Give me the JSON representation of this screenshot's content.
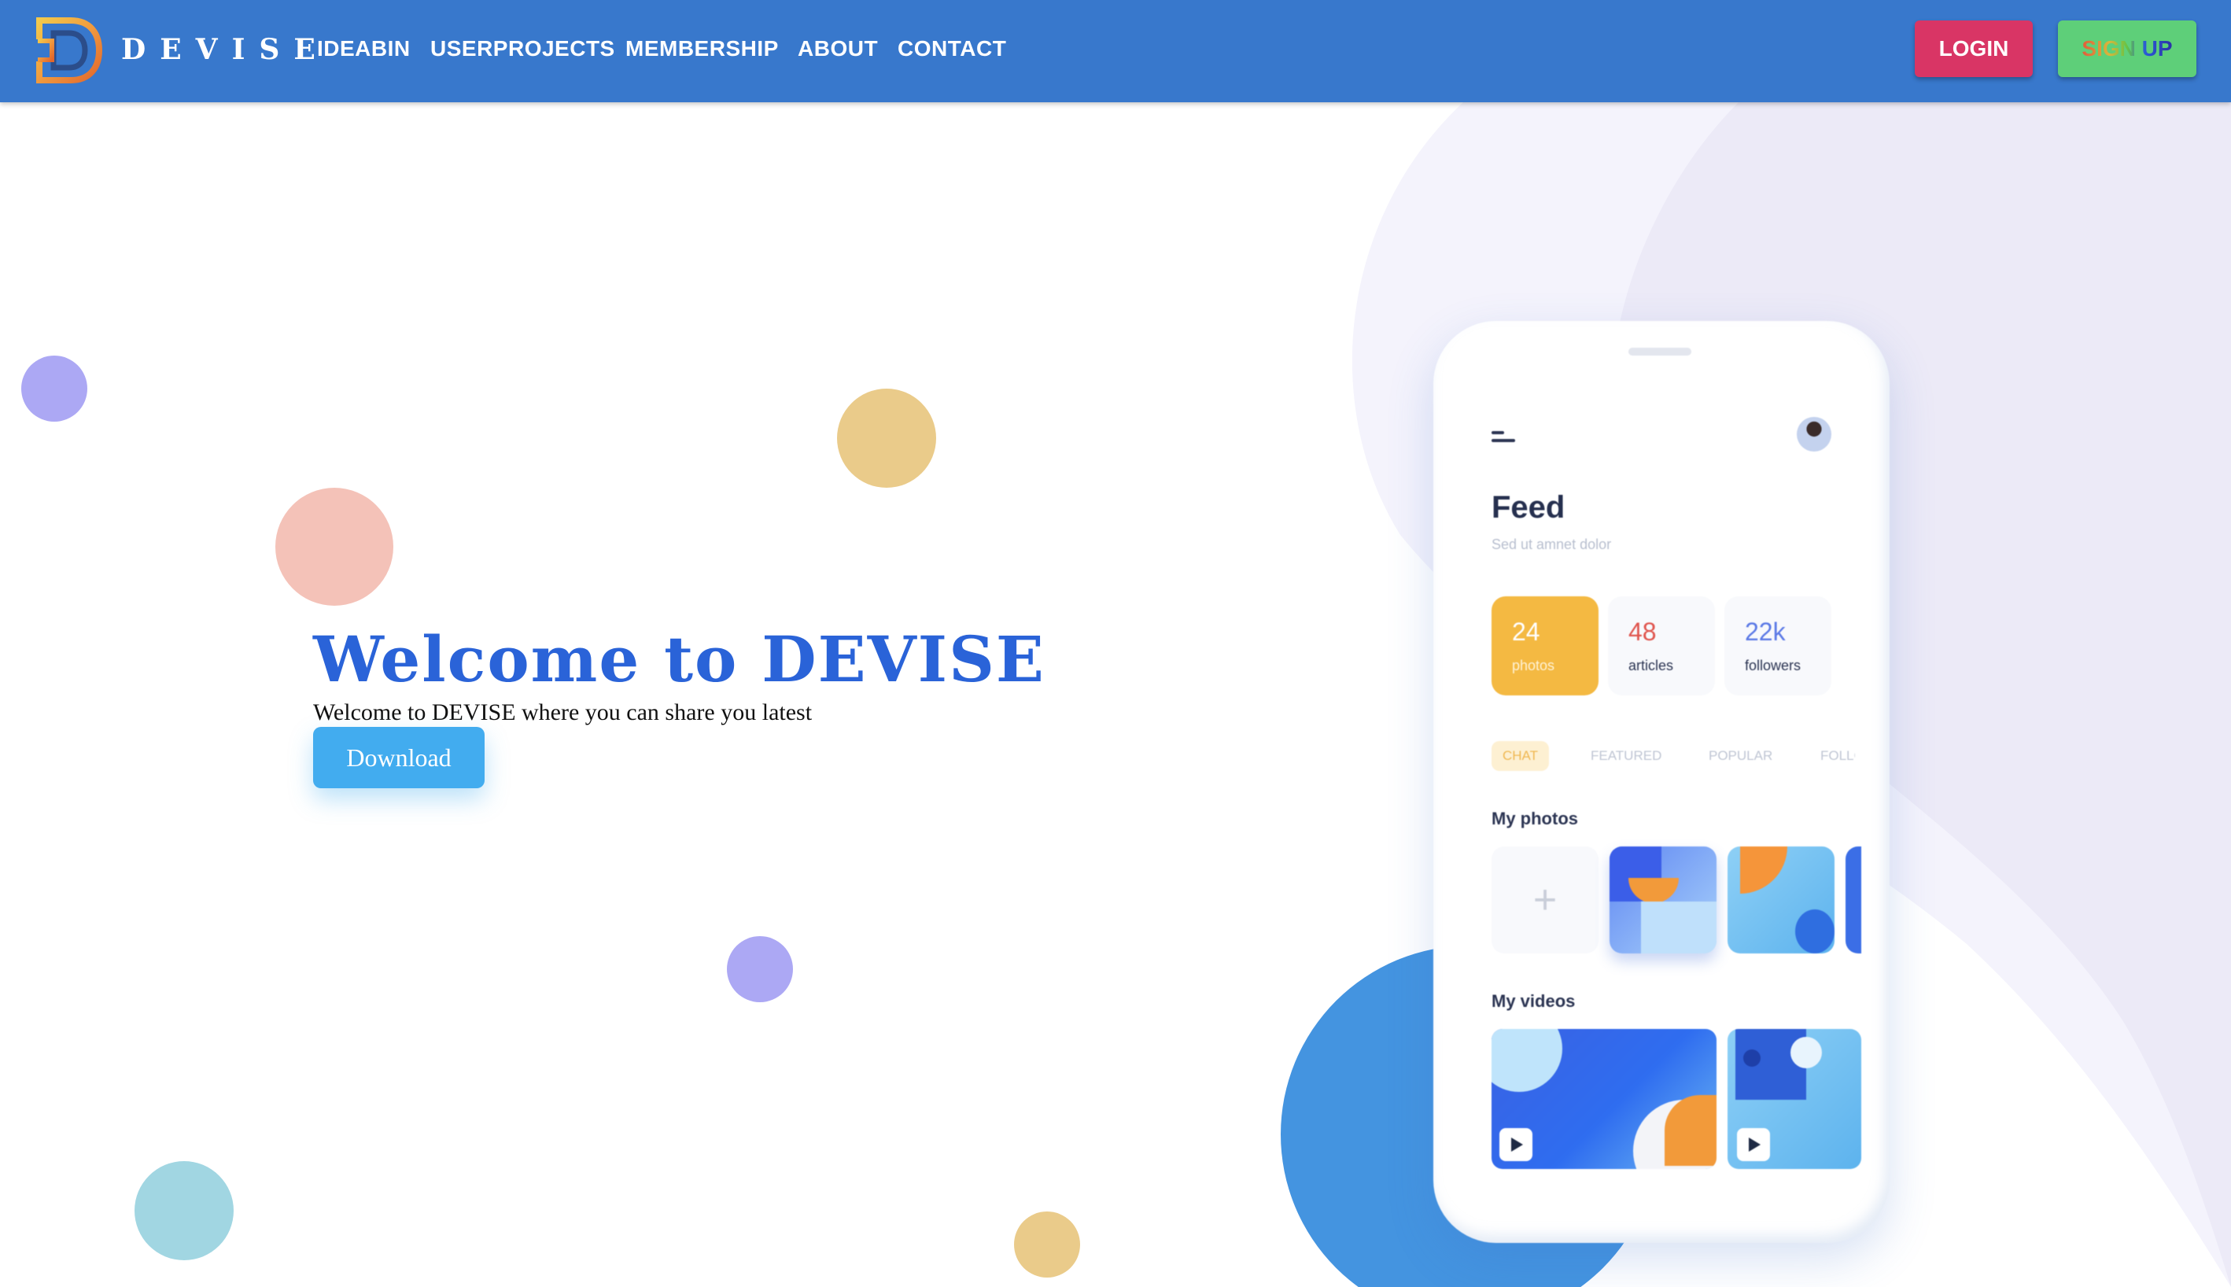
{
  "nav": {
    "brand": "DEVISE",
    "links": [
      "IDEABIN",
      "USERPROJECTS",
      "MEMBERSHIP",
      "ABOUT",
      "CONTACT"
    ],
    "login_label": "LOGIN",
    "signup_label": "SIGN UP"
  },
  "hero": {
    "title": "Welcome to DEVISE",
    "subtitle": "Welcome to DEVISE where you can share you latest",
    "download_label": "Download"
  },
  "phone": {
    "feed_title": "Feed",
    "feed_subtitle": "Sed ut amnet dolor",
    "stats": [
      {
        "value": "24",
        "label": "photos"
      },
      {
        "value": "48",
        "label": "articles"
      },
      {
        "value": "22k",
        "label": "followers"
      }
    ],
    "tabs": [
      "CHAT",
      "FEATURED",
      "POPULAR",
      "FOLLC"
    ],
    "photos_title": "My photos",
    "videos_title": "My videos",
    "add_symbol": "+"
  },
  "colors": {
    "nav_bg": "#3878cc",
    "title_blue": "#2a63d8",
    "login_bg": "#d93565",
    "signup_bg": "#5ecf79",
    "download_bg": "#42acef",
    "stat_photos_bg": "#f4b942",
    "stat_articles_text": "#e0564f",
    "stat_followers_text": "#5c7ae6"
  },
  "icons": [
    "devise-logo-icon",
    "hamburger-menu-icon",
    "avatar",
    "plus-icon",
    "play-icon"
  ]
}
